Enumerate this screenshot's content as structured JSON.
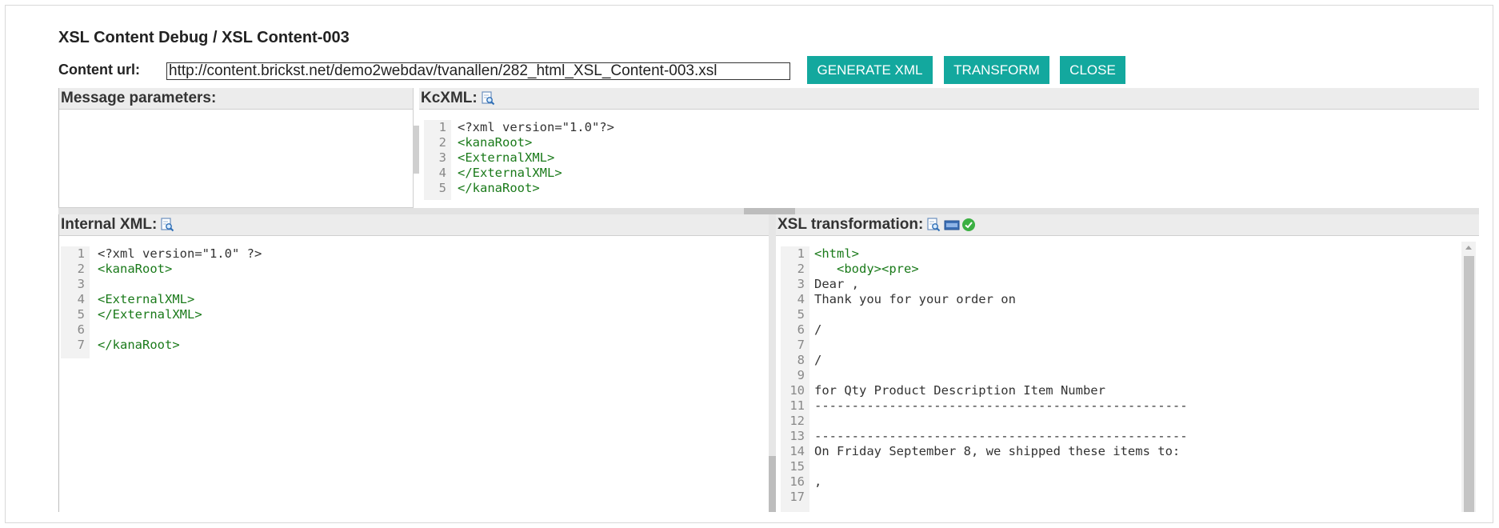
{
  "header": {
    "title": "XSL Content Debug / XSL Content-003",
    "url_label": "Content url:",
    "url_value": "http://content.brickst.net/demo2webdav/tvanallen/282_html_XSL_Content-003.xsl"
  },
  "buttons": {
    "generate": "GENERATE XML",
    "transform": "TRANSFORM",
    "close": "CLOSE"
  },
  "message_params": {
    "label": "Message parameters:"
  },
  "kcxml": {
    "label": "KcXML:",
    "lines": [
      {
        "n": "1",
        "text": "<?xml version=\"1.0\"?>",
        "kind": "txt"
      },
      {
        "n": "2",
        "text": "<kanaRoot>",
        "kind": "tag"
      },
      {
        "n": "3",
        "text": "<ExternalXML>",
        "kind": "tag"
      },
      {
        "n": "4",
        "text": "</ExternalXML>",
        "kind": "tag"
      },
      {
        "n": "5",
        "text": "</kanaRoot>",
        "kind": "tag"
      }
    ]
  },
  "internal_xml": {
    "label": "Internal XML:",
    "lines": [
      {
        "n": "1",
        "text": "<?xml version=\"1.0\" ?>",
        "kind": "txt"
      },
      {
        "n": "2",
        "text": "<kanaRoot>",
        "kind": "tag"
      },
      {
        "n": "3",
        "text": "",
        "kind": "txt"
      },
      {
        "n": "4",
        "text": "<ExternalXML>",
        "kind": "tag"
      },
      {
        "n": "5",
        "text": "</ExternalXML>",
        "kind": "tag"
      },
      {
        "n": "6",
        "text": "",
        "kind": "txt"
      },
      {
        "n": "7",
        "text": "</kanaRoot>",
        "kind": "tag"
      }
    ]
  },
  "xsl": {
    "label": "XSL transformation:",
    "lines": [
      {
        "n": "1",
        "text": "<html>",
        "kind": "tag"
      },
      {
        "n": "2",
        "text": "   <body><pre>",
        "kind": "tag"
      },
      {
        "n": "3",
        "text": "Dear ,",
        "kind": "txt"
      },
      {
        "n": "4",
        "text": "Thank you for your order on",
        "kind": "txt"
      },
      {
        "n": "5",
        "text": "",
        "kind": "txt"
      },
      {
        "n": "6",
        "text": "/",
        "kind": "txt"
      },
      {
        "n": "7",
        "text": "",
        "kind": "txt"
      },
      {
        "n": "8",
        "text": "/",
        "kind": "txt"
      },
      {
        "n": "9",
        "text": "",
        "kind": "txt"
      },
      {
        "n": "10",
        "text": "for Qty Product Description Item Number",
        "kind": "txt"
      },
      {
        "n": "11",
        "text": "--------------------------------------------------",
        "kind": "txt"
      },
      {
        "n": "12",
        "text": "",
        "kind": "txt"
      },
      {
        "n": "13",
        "text": "--------------------------------------------------",
        "kind": "txt"
      },
      {
        "n": "14",
        "text": "On Friday September 8, we shipped these items to:",
        "kind": "txt"
      },
      {
        "n": "15",
        "text": "",
        "kind": "txt"
      },
      {
        "n": "16",
        "text": ",",
        "kind": "txt"
      },
      {
        "n": "17",
        "text": "",
        "kind": "txt"
      }
    ]
  },
  "icons": {
    "preview": "document-preview-icon",
    "html": "html-view-icon",
    "status": "check-circle-icon"
  },
  "colors": {
    "button_bg": "#13a89e",
    "tag_text": "#1a7a1a",
    "panel_header_bg": "#ececec",
    "status_ok": "#3cb043"
  }
}
